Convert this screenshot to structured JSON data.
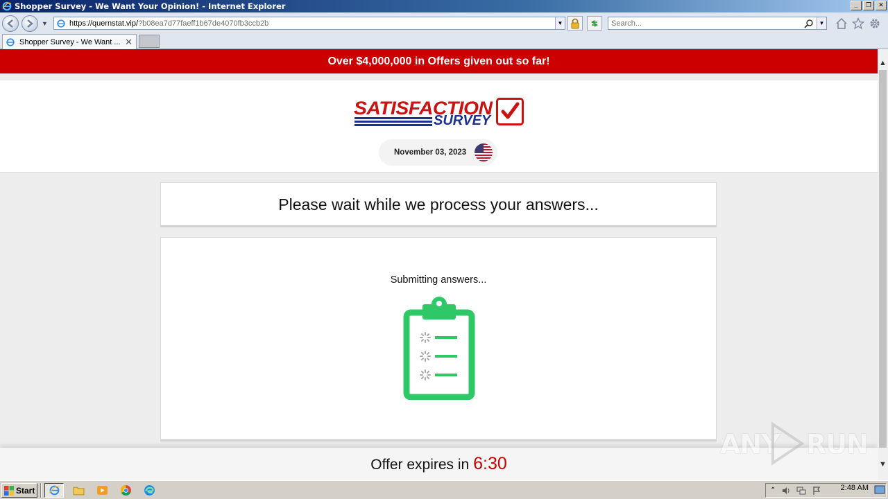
{
  "window": {
    "title": "Shopper Survey - We Want Your Opinion! - Internet Explorer",
    "buttons": {
      "minimize": "_",
      "restore": "❐",
      "close": "✕"
    }
  },
  "address_bar": {
    "url_host": "https://quernstat.vip/",
    "url_path": "?b08ea7d77faeff1b67de4070fb3ccb2b",
    "search_placeholder": "Search..."
  },
  "tabs": [
    {
      "label": "Shopper Survey - We Want ...",
      "close": "✕"
    }
  ],
  "page": {
    "banner": "Over $4,000,000 in Offers given out so far!",
    "logo": {
      "word1": "SATISFACTION",
      "word2": "SURVEY"
    },
    "date": "November 03, 2023",
    "heading": "Please wait while we process your answers...",
    "status": "Submitting answers...",
    "offer": {
      "label": "Offer expires in",
      "timer": "6:30"
    },
    "colors": {
      "banner": "#cc0000",
      "accent_green": "#2ec866",
      "logo_red": "#cc1111",
      "logo_blue": "#1d2f8f"
    }
  },
  "watermark": {
    "left": "ANY",
    "right": "RUN"
  },
  "taskbar": {
    "start_label": "Start",
    "clock": "2:48 AM",
    "apps": [
      "ie-icon",
      "folder-icon",
      "media-player-icon",
      "chrome-icon",
      "edge-icon"
    ]
  }
}
